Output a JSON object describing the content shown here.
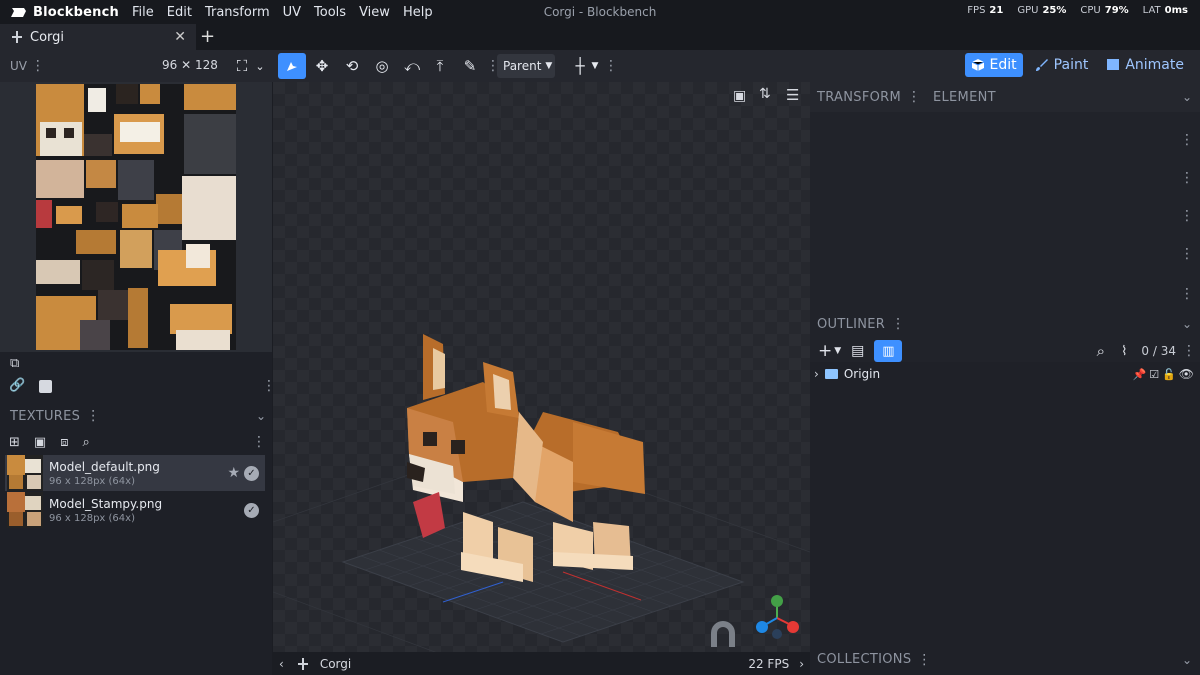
{
  "app": {
    "name": "Blockbench",
    "window_title": "Corgi - Blockbench",
    "menu": [
      "File",
      "Edit",
      "Transform",
      "UV",
      "Tools",
      "View",
      "Help"
    ],
    "perf": [
      {
        "label": "FPS",
        "value": "21"
      },
      {
        "label": "GPU",
        "value": "25%"
      },
      {
        "label": "CPU",
        "value": "79%"
      },
      {
        "label": "LAT",
        "value": "0ms"
      }
    ]
  },
  "tabs": [
    {
      "label": "Corgi"
    }
  ],
  "toolbar": {
    "uv_label": "UV",
    "uv_size": "96 ✕ 128",
    "parent_label": "Parent",
    "modes": [
      {
        "label": "Edit",
        "icon": "cube-icon",
        "active": true
      },
      {
        "label": "Paint",
        "icon": "brush-icon",
        "active": false
      },
      {
        "label": "Animate",
        "icon": "film-icon",
        "active": false
      }
    ]
  },
  "textures": {
    "title": "TEXTURES",
    "items": [
      {
        "name": "Model_default.png",
        "meta": "96 x 128px (64x)",
        "selected": true,
        "default": true
      },
      {
        "name": "Model_Stampy.png",
        "meta": "96 x 128px (64x)",
        "selected": false,
        "default": false
      }
    ]
  },
  "right": {
    "tabs": [
      "TRANSFORM",
      "ELEMENT"
    ],
    "outliner_title": "OUTLINER",
    "outliner_count": "0 / 34",
    "outliner_items": [
      {
        "label": "Origin",
        "type": "folder"
      }
    ],
    "collections_title": "COLLECTIONS"
  },
  "status": {
    "project": "Corgi",
    "fps": "22 FPS"
  },
  "colors": {
    "accent": "#3e90ff",
    "bg": "#1b1d23",
    "panel": "#25272e"
  }
}
